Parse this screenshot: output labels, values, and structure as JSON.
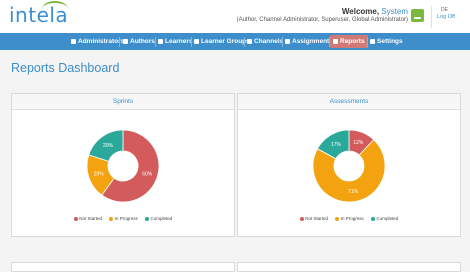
{
  "header": {
    "logo_text": "intela",
    "welcome_prefix": "Welcome,",
    "user_name": "System",
    "roles": "(Author, Channel Administrator, Superuser, Global Administrator)",
    "lang": "DE",
    "logoff": "Log Off"
  },
  "nav": {
    "items": [
      {
        "label": "Administrators",
        "icon": "person-icon"
      },
      {
        "label": "Authors",
        "icon": "people-icon"
      },
      {
        "label": "Learners",
        "icon": "person-icon"
      },
      {
        "label": "Learner Groups",
        "icon": "group-icon"
      },
      {
        "label": "Channels",
        "icon": "sitemap-icon"
      },
      {
        "label": "Assignments",
        "icon": "list-icon"
      },
      {
        "label": "Reports",
        "icon": "chart-icon",
        "active": true
      },
      {
        "label": "Settings",
        "icon": "wrench-icon"
      }
    ]
  },
  "page": {
    "title": "Reports Dashboard"
  },
  "colors": {
    "nav_bg": "#3d8ecb",
    "not_started": "#d45b5b",
    "in_progress": "#f2a30f",
    "completed": "#2aa99b"
  },
  "chart_data": [
    {
      "type": "pie",
      "title": "Sprints",
      "categories": [
        "Not Started",
        "In Progress",
        "Completed"
      ],
      "values": [
        60,
        20,
        20
      ],
      "labels": [
        "60%",
        "20%",
        "20%"
      ],
      "colors": [
        "#d45b5b",
        "#f2a30f",
        "#2aa99b"
      ],
      "donut": true,
      "legend": "bottom"
    },
    {
      "type": "pie",
      "title": "Assessments",
      "categories": [
        "Not Started",
        "In Progress",
        "Completed"
      ],
      "values": [
        12,
        71,
        17
      ],
      "labels": [
        "12%",
        "71%",
        "17%"
      ],
      "colors": [
        "#d45b5b",
        "#f2a30f",
        "#2aa99b"
      ],
      "donut": true,
      "legend": "bottom"
    }
  ]
}
